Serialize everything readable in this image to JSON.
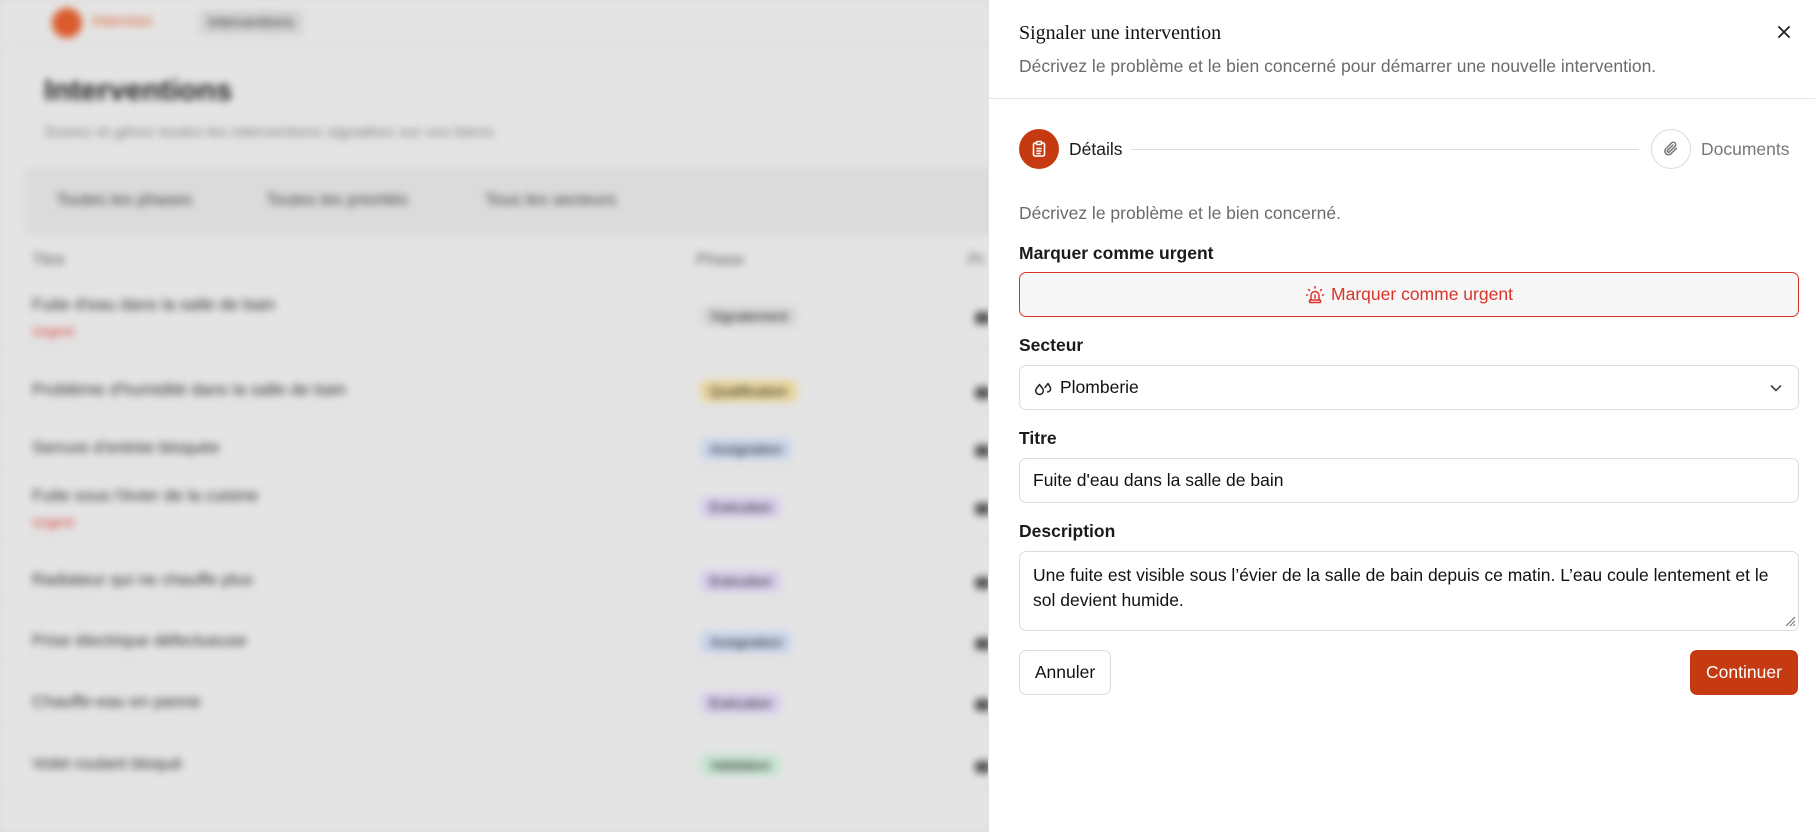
{
  "background": {
    "brand": "Interviso",
    "nav_tab": "Interventions",
    "title": "Interventions",
    "subtitle": "Suivez et gérez toutes les interventions signalées sur vos biens.",
    "filters": [
      "Toutes les phases",
      "Toutes les priorités",
      "Tous les secteurs"
    ],
    "columns": [
      "Titre",
      "Phase",
      "Pr"
    ],
    "rows": [
      {
        "title": "Fuite d'eau dans la salle de bain",
        "urgent": "Urgent",
        "phase": "Signalement",
        "phase_color": "#e6e6e6"
      },
      {
        "title": "Problème d'humidité dans la salle de bain",
        "urgent": "",
        "phase": "Qualification",
        "phase_color": "#f8e3a6"
      },
      {
        "title": "Serrure d'entrée bloquée",
        "urgent": "",
        "phase": "Assignation",
        "phase_color": "#d6e3fb"
      },
      {
        "title": "Fuite sous l'évier de la cuisine",
        "urgent": "Urgent",
        "phase": "Exécution",
        "phase_color": "#e6dafb"
      },
      {
        "title": "Radiateur qui ne chauffe plus",
        "urgent": "",
        "phase": "Exécution",
        "phase_color": "#e6dafb"
      },
      {
        "title": "Prise électrique défectueuse",
        "urgent": "",
        "phase": "Assignation",
        "phase_color": "#d6e3fb"
      },
      {
        "title": "Chauffe-eau en panne",
        "urgent": "",
        "phase": "Exécution",
        "phase_color": "#e6dafb"
      },
      {
        "title": "Volet roulant bloqué",
        "urgent": "",
        "phase": "Validation",
        "phase_color": "#d4f3df"
      }
    ]
  },
  "panel": {
    "title": "Signaler une intervention",
    "description": "Décrivez le problème et le bien concerné pour démarrer une nouvelle intervention.",
    "steps": [
      {
        "label": "Détails",
        "icon": "clipboard-icon",
        "active": true
      },
      {
        "label": "Documents",
        "icon": "paperclip-icon",
        "active": false
      }
    ],
    "intro": "Décrivez le problème et le bien concerné.",
    "urgent": {
      "label": "Marquer comme urgent",
      "button_label": "Marquer comme urgent",
      "icon": "siren-icon"
    },
    "sector": {
      "label": "Secteur",
      "value": "Plomberie",
      "icon": "droplets-icon"
    },
    "title_field": {
      "label": "Titre",
      "value": "Fuite d'eau dans la salle de bain"
    },
    "description_field": {
      "label": "Description",
      "value": "Une fuite est visible sous l’évier de la salle de bain depuis ce matin. L’eau coule lentement et le sol devient humide."
    },
    "cancel_label": "Annuler",
    "continue_label": "Continuer"
  },
  "colors": {
    "accent": "#c63a12",
    "urgent": "#d9342b"
  }
}
